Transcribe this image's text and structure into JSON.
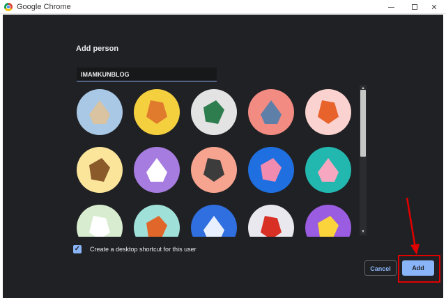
{
  "window": {
    "title": "Google Chrome"
  },
  "dialog": {
    "heading": "Add person",
    "name_value": "IMAMKUNBLOG",
    "shortcut_label": "Create a desktop shortcut for this user",
    "shortcut_checked": true,
    "cancel_label": "Cancel",
    "add_label": "Add"
  },
  "avatars": [
    {
      "name": "cat",
      "bg": "#a8c8e6",
      "color": "#d9c3a0"
    },
    {
      "name": "corgi",
      "bg": "#f4d03f",
      "color": "#e07b2e"
    },
    {
      "name": "dragon",
      "bg": "#e3e3e3",
      "color": "#2e7d4f"
    },
    {
      "name": "elephant",
      "bg": "#f28b82",
      "color": "#5e7fa8"
    },
    {
      "name": "fox",
      "bg": "#fad2cf",
      "color": "#e8622c"
    },
    {
      "name": "monkey",
      "bg": "#fbe59a",
      "color": "#8a5a2b"
    },
    {
      "name": "panda",
      "bg": "#a67ce0",
      "color": "#ffffff"
    },
    {
      "name": "penguin",
      "bg": "#f6a38f",
      "color": "#3c3c3c"
    },
    {
      "name": "butterfly",
      "bg": "#1f6fe0",
      "color": "#f28bb0"
    },
    {
      "name": "rabbit",
      "bg": "#22b8b0",
      "color": "#f7a8c0"
    },
    {
      "name": "unicorn",
      "bg": "#d8ecd0",
      "color": "#ffffff"
    },
    {
      "name": "basketball",
      "bg": "#9fe0d8",
      "color": "#e0662a"
    },
    {
      "name": "bike",
      "bg": "#2f6fe0",
      "color": "#e8f0ff"
    },
    {
      "name": "bird",
      "bg": "#e8e8ee",
      "color": "#d93025"
    },
    {
      "name": "cheese",
      "bg": "#9a5ce0",
      "color": "#fbd33a"
    }
  ],
  "annotation": {
    "highlight_color": "#e00000"
  }
}
